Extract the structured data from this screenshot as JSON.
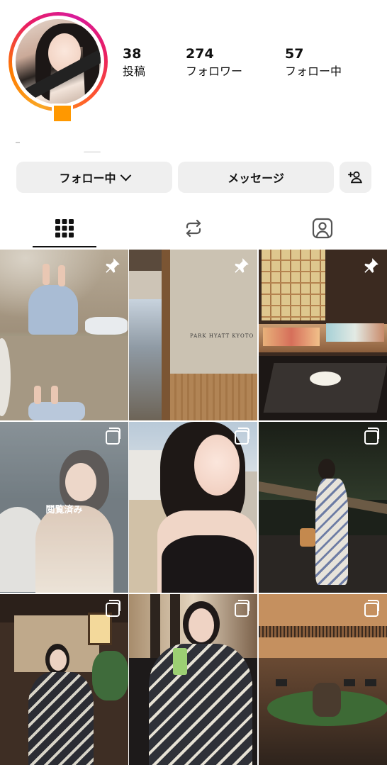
{
  "profile": {
    "stats": [
      {
        "value": "38",
        "label": "投稿"
      },
      {
        "value": "274",
        "label": "フォロワー"
      },
      {
        "value": "57",
        "label": "フォロー中"
      }
    ]
  },
  "buttons": {
    "following_label": "フォロー中",
    "message_label": "メッセージ"
  },
  "tabs": [
    {
      "name": "grid",
      "icon": "grid-icon",
      "selected": true
    },
    {
      "name": "reposts",
      "icon": "repost-icon",
      "selected": false
    },
    {
      "name": "tagged",
      "icon": "tagged-person-icon",
      "selected": false
    }
  ],
  "posts": [
    {
      "badge": "pin-icon",
      "seen": ""
    },
    {
      "badge": "pin-icon",
      "seen": "",
      "caption": "PARK HYATT KYOTO"
    },
    {
      "badge": "pin-icon",
      "seen": ""
    },
    {
      "badge": "carousel-icon",
      "seen": "閲覧済み"
    },
    {
      "badge": "carousel-icon",
      "seen": ""
    },
    {
      "badge": "carousel-icon",
      "seen": ""
    },
    {
      "badge": "carousel-icon",
      "seen": ""
    },
    {
      "badge": "carousel-icon",
      "seen": ""
    },
    {
      "badge": "carousel-icon",
      "seen": ""
    }
  ],
  "colors": {
    "story_ring": [
      "#f9a825",
      "#e91e63",
      "#d81b9a"
    ],
    "status_dot": "#ff9800",
    "button_bg": "#efefef"
  }
}
